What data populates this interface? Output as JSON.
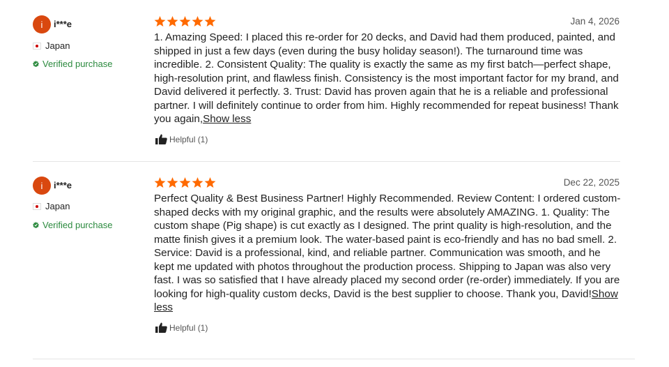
{
  "reviews": [
    {
      "avatar_letter": "i",
      "username": "i***e",
      "country": "Japan",
      "verified": "Verified purchase",
      "rating": 5,
      "date": "Jan 4, 2026",
      "text": "1. Amazing Speed: I placed this re-order for 20 decks, and David had them produced, painted, and shipped in just a few days (even during the busy holiday season!). The turnaround time was incredible. 2. Consistent Quality: The quality is exactly the same as my first batch—perfect shape, high-resolution print, and flawless finish. Consistency is the most important factor for my brand, and David delivered it perfectly. 3. Trust: David has proven again that he is a reliable and professional partner. I will definitely continue to order from him. Highly recommended for repeat business! Thank you again,",
      "show_less": "Show less",
      "helpful": "Helpful (1)"
    },
    {
      "avatar_letter": "i",
      "username": "i***e",
      "country": "Japan",
      "verified": "Verified purchase",
      "rating": 5,
      "date": "Dec 22, 2025",
      "text": "Perfect Quality & Best Business Partner! Highly Recommended. Review Content: I ordered custom-shaped decks with my original graphic, and the results were absolutely AMAZING. 1. Quality: The custom shape (Pig shape) is cut exactly as I designed. The print quality is high-resolution, and the matte finish gives it a premium look. The water-based paint is eco-friendly and has no bad smell. 2. Service: David is a professional, kind, and reliable partner. Communication was smooth, and he kept me updated with photos throughout the production process. Shipping to Japan was also very fast. I was so satisfied that I have already placed my second order (re-order) immediately. If you are looking for high-quality custom decks, David is the best supplier to choose. Thank you, David!",
      "show_less": "Show less",
      "helpful": "Helpful (1)"
    }
  ],
  "colors": {
    "star": "#ff6a00",
    "avatar": "#d9480f",
    "verified": "#2b8a3e"
  }
}
